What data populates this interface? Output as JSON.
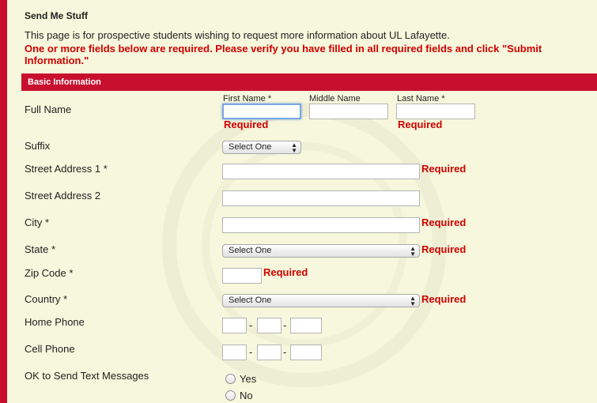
{
  "page": {
    "title": "Send Me Stuff",
    "intro": "This page is for prospective students wishing to request more information about UL Lafayette.",
    "error": "One or more fields below are required. Please verify you have filled in all required fields and click \"Submit Information.\""
  },
  "section": {
    "title": "Basic Information"
  },
  "required_text": "Required",
  "full_name": {
    "label": "Full Name",
    "first_label": "First Name *",
    "middle_label": "Middle Name",
    "last_label": "Last Name *"
  },
  "suffix": {
    "label": "Suffix",
    "selected": "Select One"
  },
  "street1": {
    "label": "Street Address 1 *"
  },
  "street2": {
    "label": "Street Address 2"
  },
  "city": {
    "label": "City *"
  },
  "state": {
    "label": "State *",
    "selected": "Select One"
  },
  "zip": {
    "label": "Zip Code *"
  },
  "country": {
    "label": "Country *",
    "selected": "Select One"
  },
  "home_phone": {
    "label": "Home Phone"
  },
  "cell_phone": {
    "label": "Cell Phone"
  },
  "text_messages": {
    "label": "OK to Send Text Messages",
    "options": [
      "Yes",
      "No"
    ]
  },
  "colors": {
    "accent": "#c8102e",
    "error": "#d00000",
    "background": "#f6f7dc"
  }
}
